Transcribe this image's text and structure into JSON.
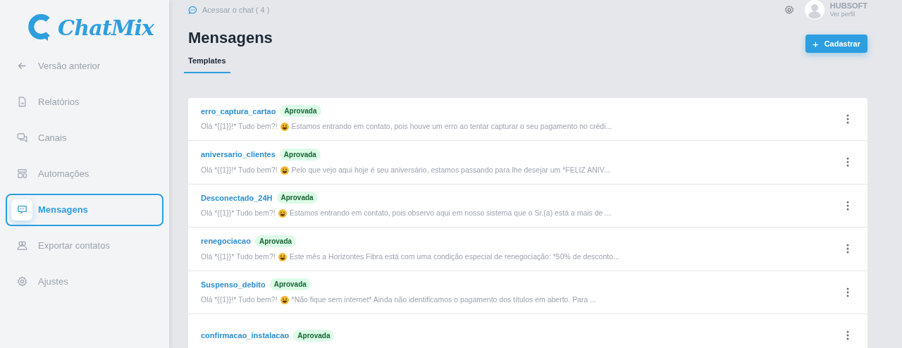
{
  "logo": {
    "text": "ChatMix"
  },
  "sidebar": {
    "items": [
      {
        "label": "Versão anterior",
        "kind": "back",
        "selected": false
      },
      {
        "label": "Relatórios",
        "kind": "report",
        "selected": false
      },
      {
        "label": "Canais",
        "kind": "chats",
        "selected": false
      },
      {
        "label": "Automações",
        "kind": "layout",
        "selected": false
      },
      {
        "label": "Mensagens",
        "kind": "message",
        "selected": true
      },
      {
        "label": "Exportar contatos",
        "kind": "users",
        "selected": false
      },
      {
        "label": "Ajustes",
        "kind": "gear",
        "selected": false
      }
    ]
  },
  "topbar": {
    "chat_link": "Acessar o chat ( 4 )",
    "user": {
      "name": "HUBSOFT",
      "link": "Ver perfil"
    }
  },
  "page": {
    "title": "Mensagens",
    "tabs": [
      {
        "label": "Templates",
        "selected": true
      }
    ],
    "button": "Cadastrar",
    "button_icon": "+"
  },
  "templates": [
    {
      "name": "erro_captura_cartao",
      "status": "Aprovada",
      "preview_start": "Olá *{{1}}!* Tudo bem?!",
      "preview_end": "Estamos entrando em contato, pois houve um erro ao tentar capturar o seu pagamento no crédi..."
    },
    {
      "name": "aniversario_clientes",
      "status": "Aprovada",
      "preview_start": "Olá *{{1}}!* Tudo bem?!",
      "preview_end": "Pelo que vejo aqui hoje é seu aniversário, estamos passando para lhe desejar um *FELIZ ANIV..."
    },
    {
      "name": "Desconectado_24H",
      "status": "Aprovada",
      "preview_start": "Olá *{{1}}* Tudo bem?!",
      "preview_end": "Estamos entrando em contato, pois observo aqui em nosso sistema que o Sr.(a) está a mais de ..."
    },
    {
      "name": "renegociacao",
      "status": "Aprovada",
      "preview_start": "Olá *{{1}}* Tudo bem?!",
      "preview_end": "Este mês a Horizontes Fibra está com uma condição especial de renegociação: *50% de desconto..."
    },
    {
      "name": "Suspenso_debito",
      "status": "Aprovada",
      "preview_start": "Olá *{{1}}!* Tudo bem?!",
      "preview_end": "*Não fique sem internet* Ainda não identificamos o pagamento dos títulos em aberto. Para ..."
    },
    {
      "name": "confirmacao_instalacao",
      "status": "Aprovada"
    }
  ]
}
